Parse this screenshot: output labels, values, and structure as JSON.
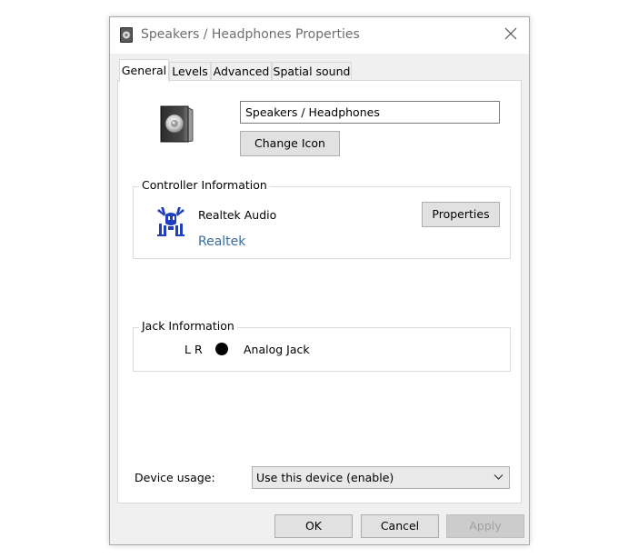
{
  "window": {
    "title": "Speakers / Headphones Properties"
  },
  "tabs": [
    {
      "label": "General",
      "active": true
    },
    {
      "label": "Levels",
      "active": false
    },
    {
      "label": "Advanced",
      "active": false
    },
    {
      "label": "Spatial sound",
      "active": false
    }
  ],
  "general": {
    "device_name_value": "Speakers / Headphones",
    "change_icon_label": "Change Icon",
    "controller": {
      "group_label": "Controller Information",
      "name": "Realtek Audio",
      "link": "Realtek",
      "properties_label": "Properties",
      "icon": "realtek-crab-logo"
    },
    "jack": {
      "group_label": "Jack Information",
      "channels": "L R",
      "name": "Analog Jack",
      "dot_color": "#000000"
    },
    "device_usage": {
      "label": "Device usage:",
      "selected": "Use this device (enable)"
    }
  },
  "footer": {
    "ok_label": "OK",
    "cancel_label": "Cancel",
    "apply_label": "Apply",
    "apply_disabled": true
  },
  "icons": {
    "title": "speaker-icon",
    "close": "close-icon",
    "device": "speaker-icon",
    "dropdown": "chevron-down-icon"
  },
  "colors": {
    "link": "#3a6b9a",
    "window_bg": "#f0f0f0",
    "panel_bg": "#ffffff",
    "button_bg": "#e1e1e1"
  }
}
